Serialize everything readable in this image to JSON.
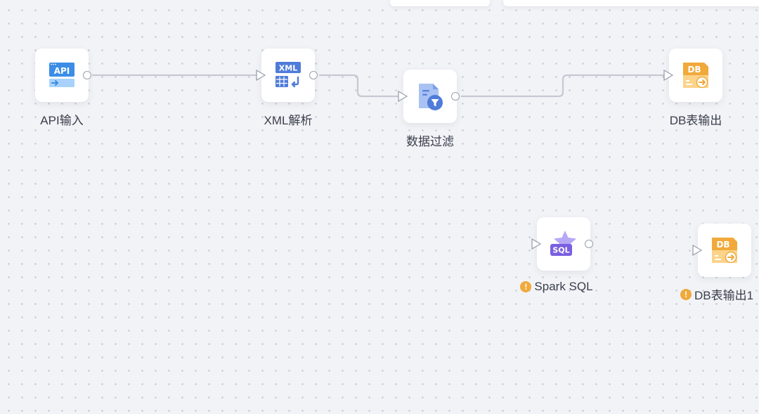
{
  "nodes": {
    "api_input": {
      "label": "API输入",
      "icon": "api-input-icon",
      "icon_text": "API",
      "color": "#3b8de6"
    },
    "xml_parse": {
      "label": "XML解析",
      "icon": "xml-parse-icon",
      "icon_text": "XML",
      "color": "#4f7bd9"
    },
    "data_filter": {
      "label": "数据过滤",
      "icon": "data-filter-icon",
      "color": "#5a82dc"
    },
    "db_output": {
      "label": "DB表输出",
      "icon": "db-output-icon",
      "icon_text": "DB",
      "color": "#f0a93a"
    },
    "spark_sql": {
      "label": "Spark SQL",
      "icon": "spark-sql-icon",
      "icon_text": "SQL",
      "color": "#7a5fe0",
      "warning": true
    },
    "db_output_1": {
      "label": "DB表输出1",
      "icon": "db-output-icon",
      "icon_text": "DB",
      "color": "#f0a93a",
      "warning": true
    }
  },
  "edges": [
    {
      "from": "API输入",
      "to": "XML解析"
    },
    {
      "from": "XML解析",
      "to": "数据过滤"
    },
    {
      "from": "数据过滤",
      "to": "DB表输出"
    }
  ],
  "colors": {
    "canvas_bg": "#f2f3f7",
    "grid_dot": "#c3c7d0",
    "edge": "#c5c9d2",
    "port": "#9aa0ad",
    "warning": "#f0a93a"
  }
}
